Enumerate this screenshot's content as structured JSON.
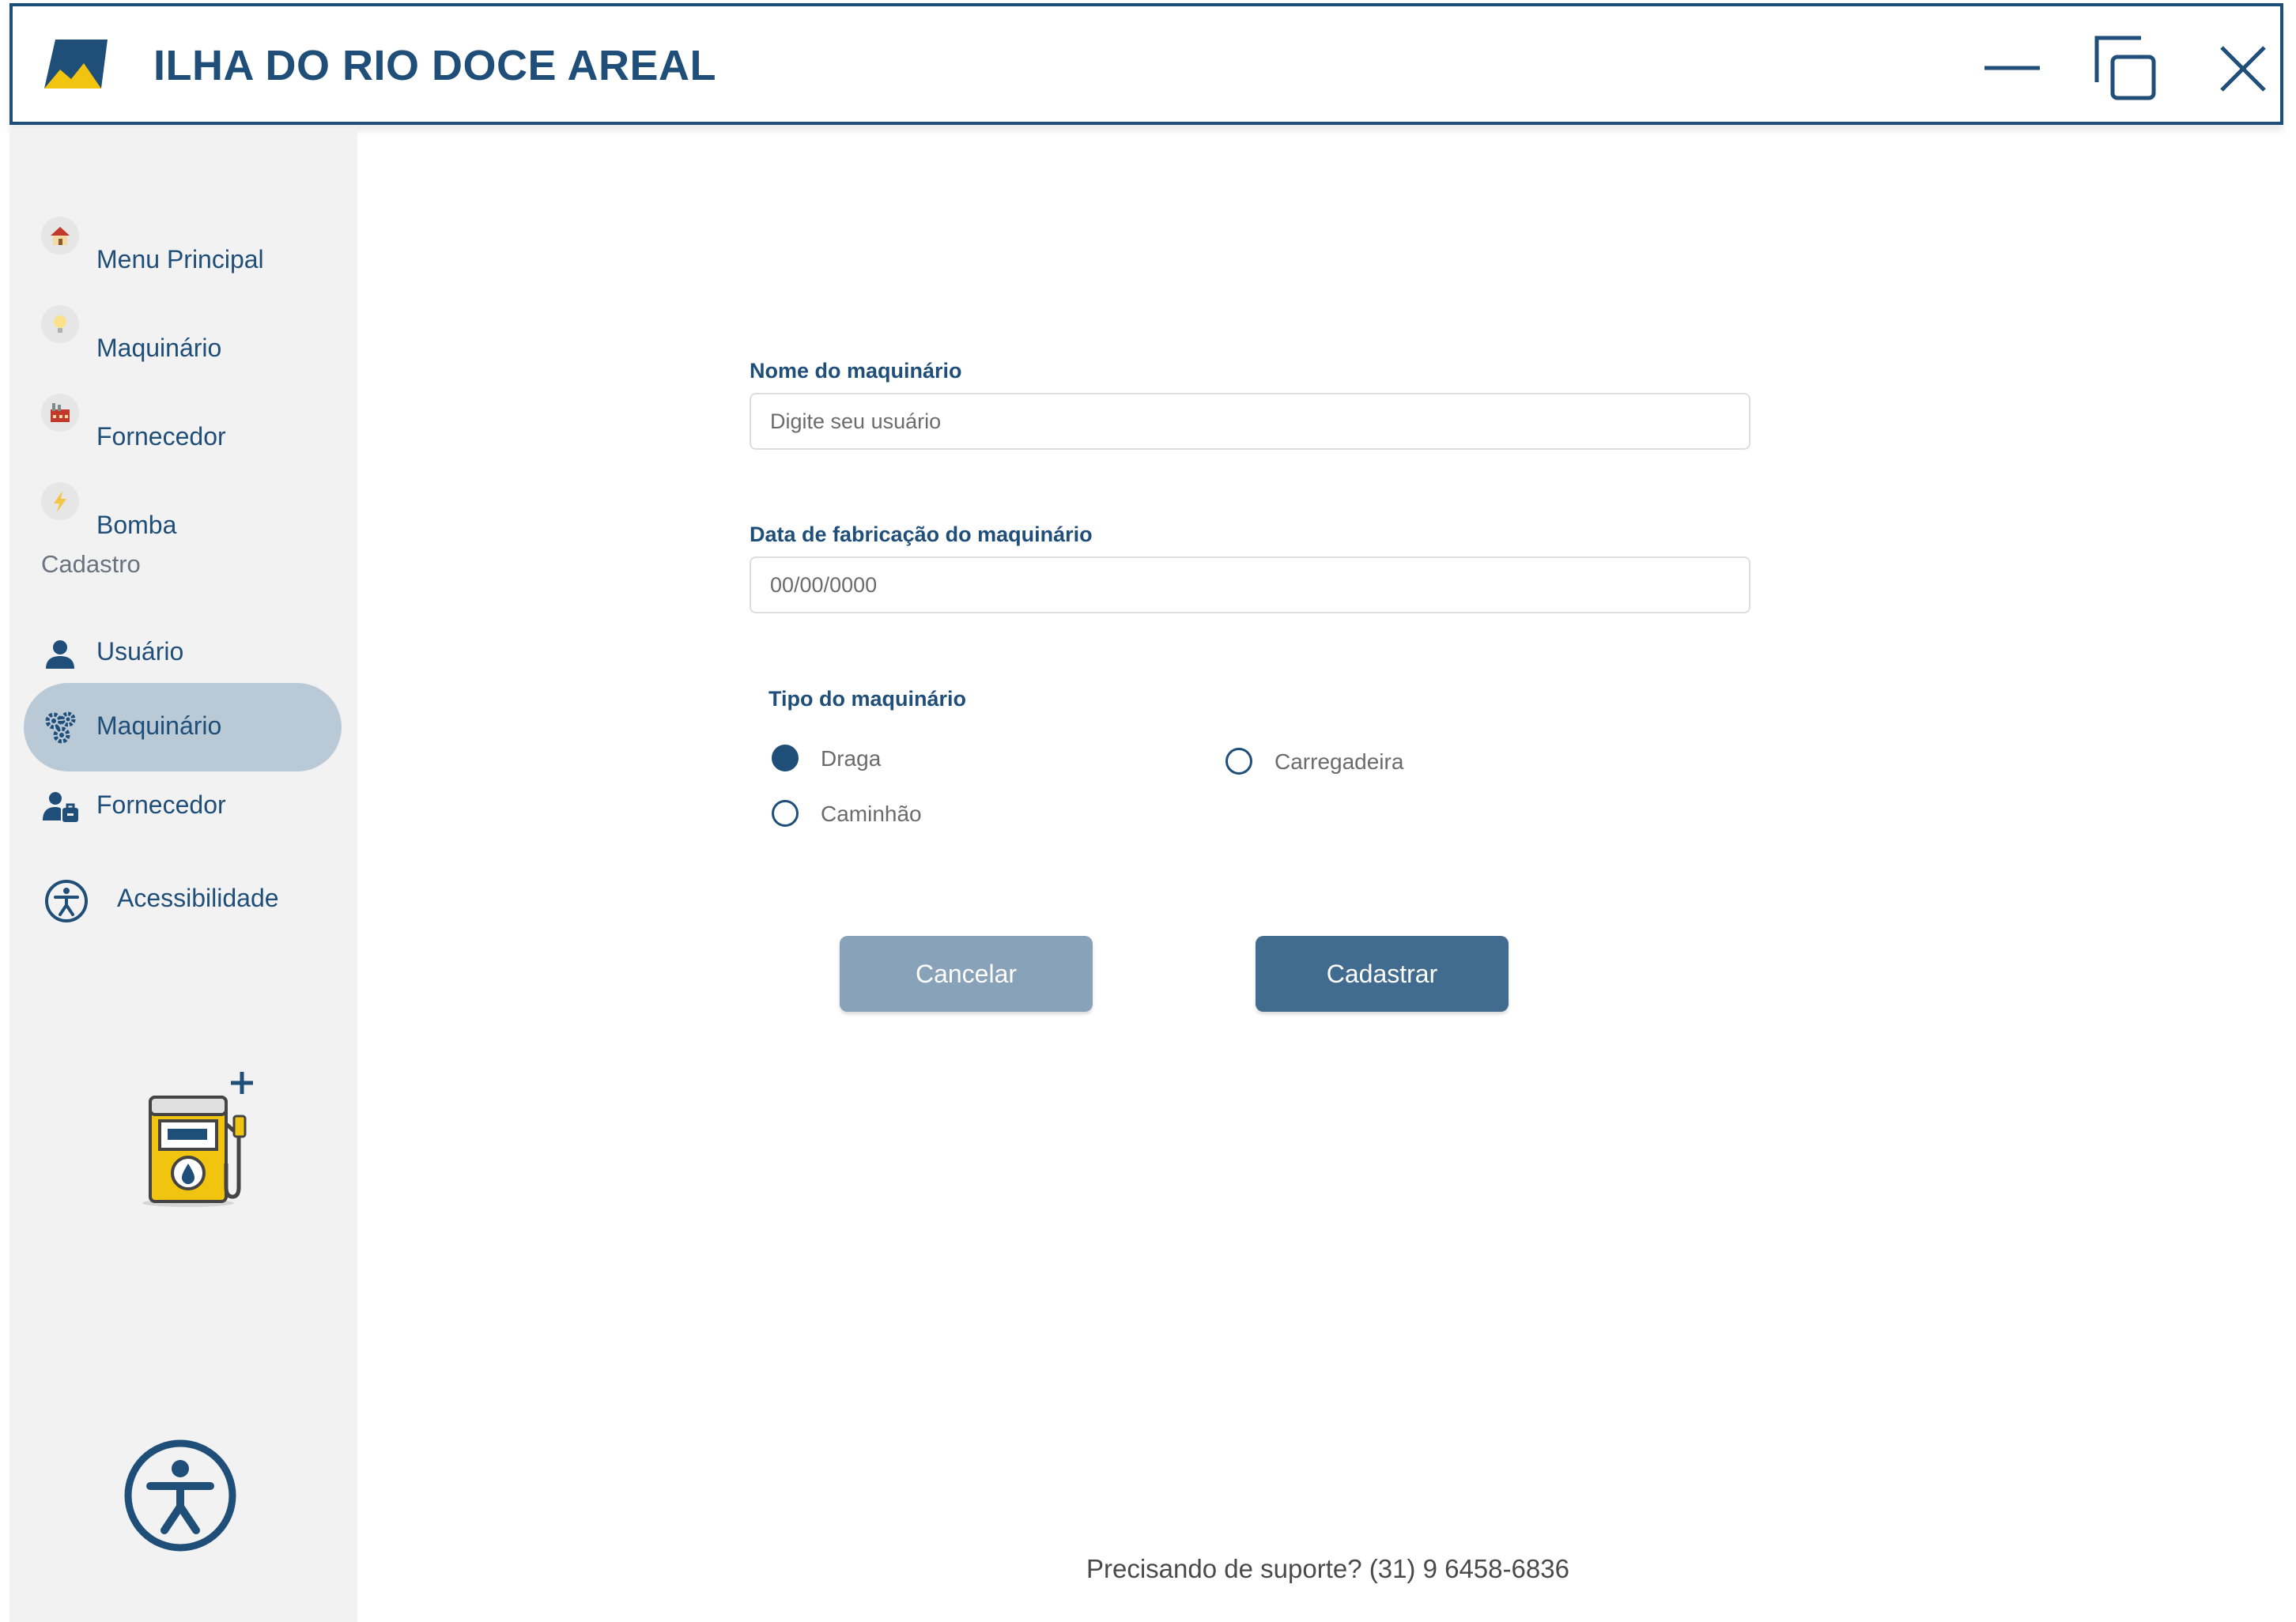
{
  "app": {
    "title": "ILHA DO RIO DOCE AREAL",
    "colors": {
      "primary": "#1f4e79",
      "accent": "#f1c40f",
      "active_bg": "#b9cad6",
      "sidebar_bg": "#f2f2f2"
    }
  },
  "window_controls": {
    "icons": [
      "minimize-icon",
      "restore-icon",
      "close-icon"
    ]
  },
  "sidebar": {
    "main_items": [
      {
        "label": "Menu Principal",
        "icon": "house-icon"
      },
      {
        "label": "Maquinário",
        "icon": "lightbulb-icon"
      },
      {
        "label": "Fornecedor",
        "icon": "factory-icon"
      },
      {
        "label": "Bomba",
        "icon": "lightning-icon"
      }
    ],
    "section_label": "Cadastro",
    "cadastro_items": [
      {
        "label": "Usuário",
        "icon": "user-icon",
        "active": false
      },
      {
        "label": "Maquinário",
        "icon": "gears-icon",
        "active": true
      },
      {
        "label": "Fornecedor",
        "icon": "supplier-icon",
        "active": false
      }
    ],
    "accessibility_label": "Acessibilidade"
  },
  "form": {
    "name_label": "Nome do maquinário",
    "name_placeholder": "Digite seu usuário",
    "name_value": "",
    "date_label": "Data de fabricação do maquinário",
    "date_placeholder": "00/00/0000",
    "date_value": "",
    "type_label": "Tipo do  maquinário",
    "type_options": [
      {
        "label": "Draga",
        "checked": true
      },
      {
        "label": "Carregadeira",
        "checked": false
      },
      {
        "label": "Caminhão",
        "checked": false
      }
    ],
    "cancel_label": "Cancelar",
    "submit_label": "Cadastrar"
  },
  "footer": {
    "support_text": "Precisando de suporte? (31) 9 6458-6836"
  }
}
